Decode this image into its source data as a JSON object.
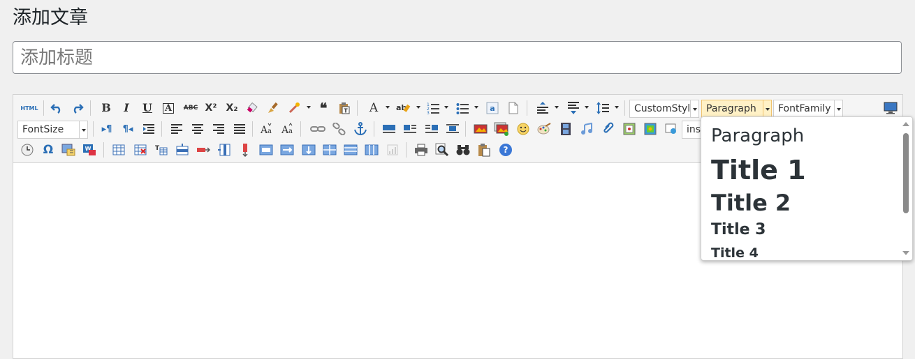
{
  "page": {
    "title": "添加文章",
    "title_placeholder": "添加标题"
  },
  "toolbar": {
    "html_label": "HTML",
    "custom_style": "CustomStyl",
    "paragraph": "Paragraph",
    "font_family": "FontFamily",
    "font_size": "FontSize",
    "insert_code": "inse",
    "glyphs": {
      "bold": "B",
      "italic": "I",
      "underline": "U",
      "font_border": "A",
      "strike": "ABC",
      "superscript": "X²",
      "subscript": "X₂",
      "quote": "❝",
      "font_color": "A",
      "omega": "Ω",
      "help": "?",
      "ltr": "▸¶",
      "rtl": "¶◂"
    }
  },
  "dropdown": {
    "items": [
      "Paragraph",
      "Title 1",
      "Title 2",
      "Title 3",
      "Title 4"
    ]
  },
  "colors": {
    "accent_blue": "#2b6fb6",
    "active_combo": "#fff1c6"
  }
}
